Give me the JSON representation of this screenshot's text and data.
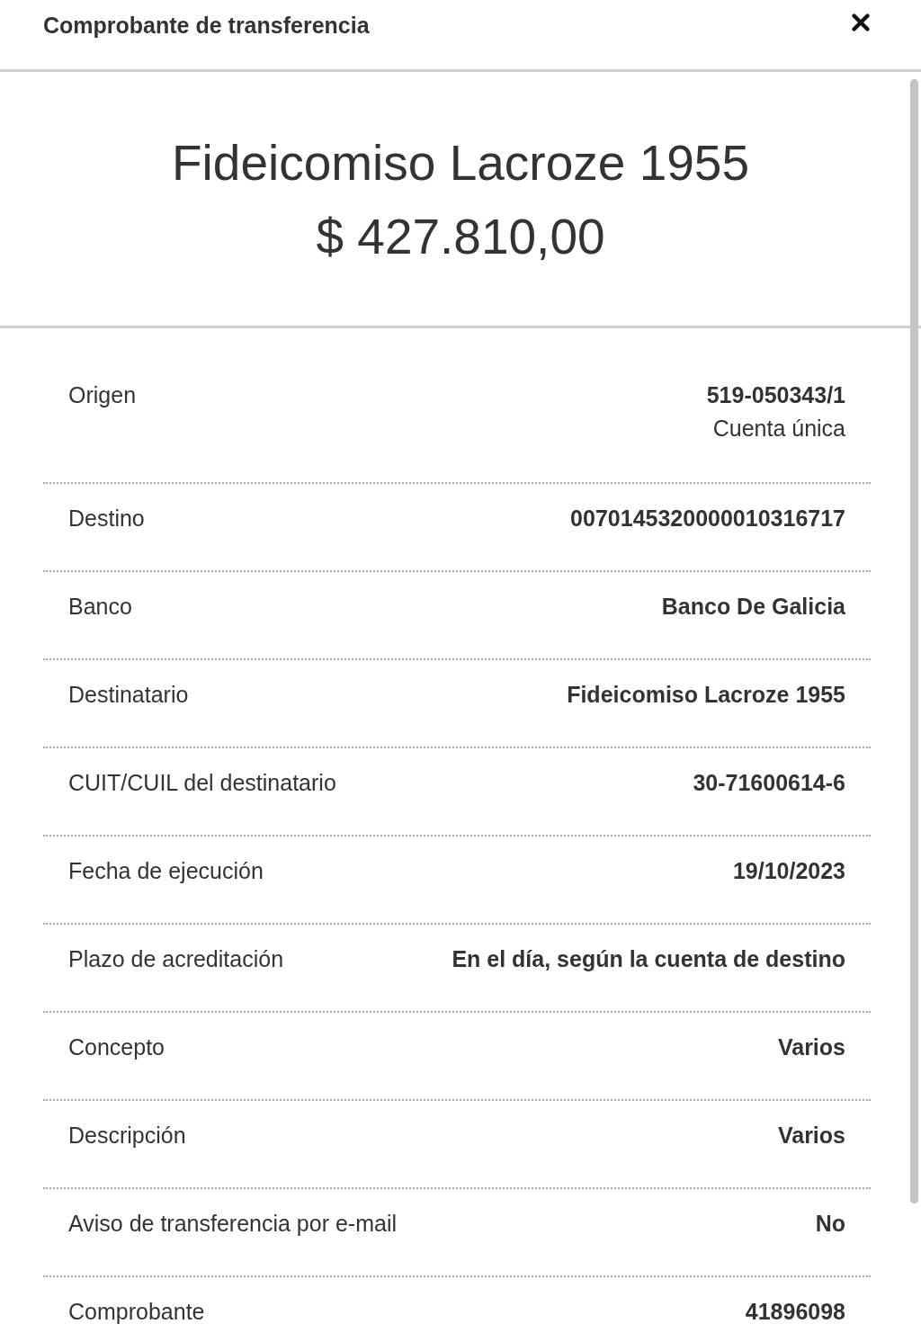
{
  "header": {
    "title": "Comprobante de transferencia"
  },
  "hero": {
    "name": "Fideicomiso Lacroze 1955",
    "amount": "$ 427.810,00"
  },
  "rows": [
    {
      "label": "Origen",
      "value": "519-050343/1",
      "detail": "Cuenta única"
    },
    {
      "label": "Destino",
      "value": "0070145320000010316717"
    },
    {
      "label": "Banco",
      "value": "Banco De Galicia"
    },
    {
      "label": "Destinatario",
      "value": "Fideicomiso Lacroze 1955"
    },
    {
      "label": "CUIT/CUIL del destinatario",
      "value": "30-71600614-6"
    },
    {
      "label": "Fecha de ejecución",
      "value": "19/10/2023"
    },
    {
      "label": "Plazo de acreditación",
      "value": "En el día, según la cuenta de destino"
    },
    {
      "label": "Concepto",
      "value": "Varios"
    },
    {
      "label": "Descripción",
      "value": "Varios"
    },
    {
      "label": "Aviso de transferencia por e-mail",
      "value": "No"
    },
    {
      "label": "Comprobante",
      "value": "41896098"
    }
  ]
}
